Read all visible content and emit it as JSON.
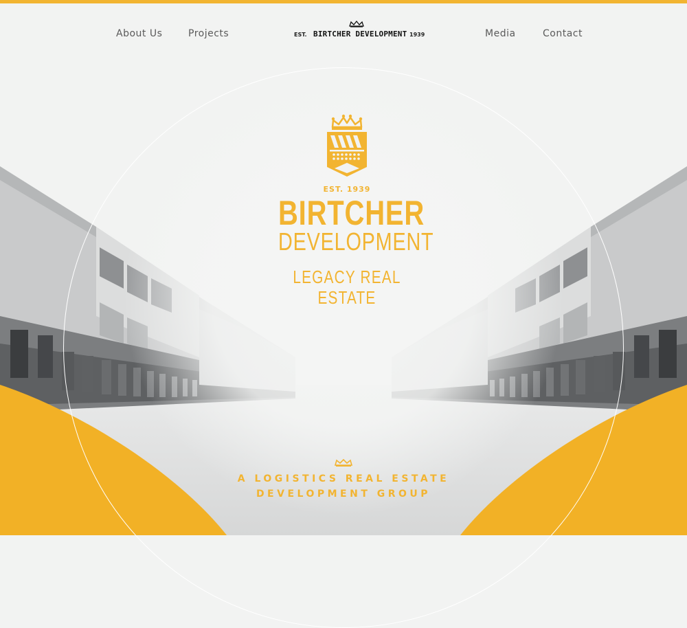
{
  "nav": {
    "items_left": [
      "About Us",
      "Projects"
    ],
    "items_right": [
      "Media",
      "Contact"
    ],
    "logo": {
      "est": "EST.",
      "name": "BIRTCHER DEVELOPMENT",
      "year": "1939"
    }
  },
  "hero": {
    "est_line": "EST. 1939",
    "title_1": "BIRTCHER",
    "title_2": "DEVELOPMENT",
    "subtitle": "LEGACY REAL ESTATE"
  },
  "tagline": {
    "line_1": "A LOGISTICS REAL ESTATE",
    "line_2": "DEVELOPMENT GROUP"
  },
  "colors": {
    "accent": "#f2b431",
    "background": "#f2f3f2",
    "text": "#5a5a5a"
  },
  "icons": [
    "crown-icon",
    "shield-logo-icon"
  ]
}
